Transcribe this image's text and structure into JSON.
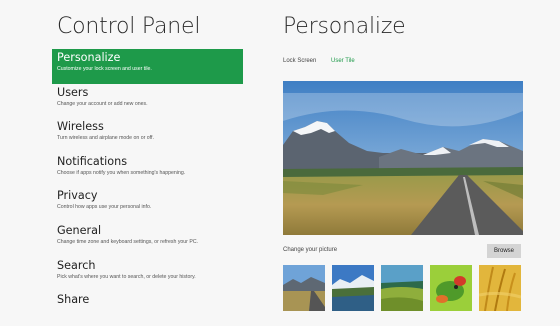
{
  "control_panel": {
    "title": "Control Panel",
    "items": [
      {
        "label": "Personalize",
        "desc": "Customize your lock screen and user tile.",
        "selected": true
      },
      {
        "label": "Users",
        "desc": "Change your account or add new ones."
      },
      {
        "label": "Wireless",
        "desc": "Turn wireless and airplane mode on or off."
      },
      {
        "label": "Notifications",
        "desc": "Choose if apps notify you when something's happening."
      },
      {
        "label": "Privacy",
        "desc": "Control how apps use your personal info."
      },
      {
        "label": "General",
        "desc": "Change time zone and keyboard settings, or refresh your PC."
      },
      {
        "label": "Search",
        "desc": "Pick what's where you want to search, or delete your history."
      },
      {
        "label": "Share",
        "desc": ""
      }
    ]
  },
  "personalize": {
    "title": "Personalize",
    "tabs": [
      {
        "label": "Lock Screen",
        "active": false
      },
      {
        "label": "User Tile",
        "active": true
      }
    ],
    "change_picture_label": "Change your picture",
    "browse_label": "Browse"
  },
  "colors": {
    "accent": "#1e9a4a",
    "background": "#f7f7f7"
  }
}
